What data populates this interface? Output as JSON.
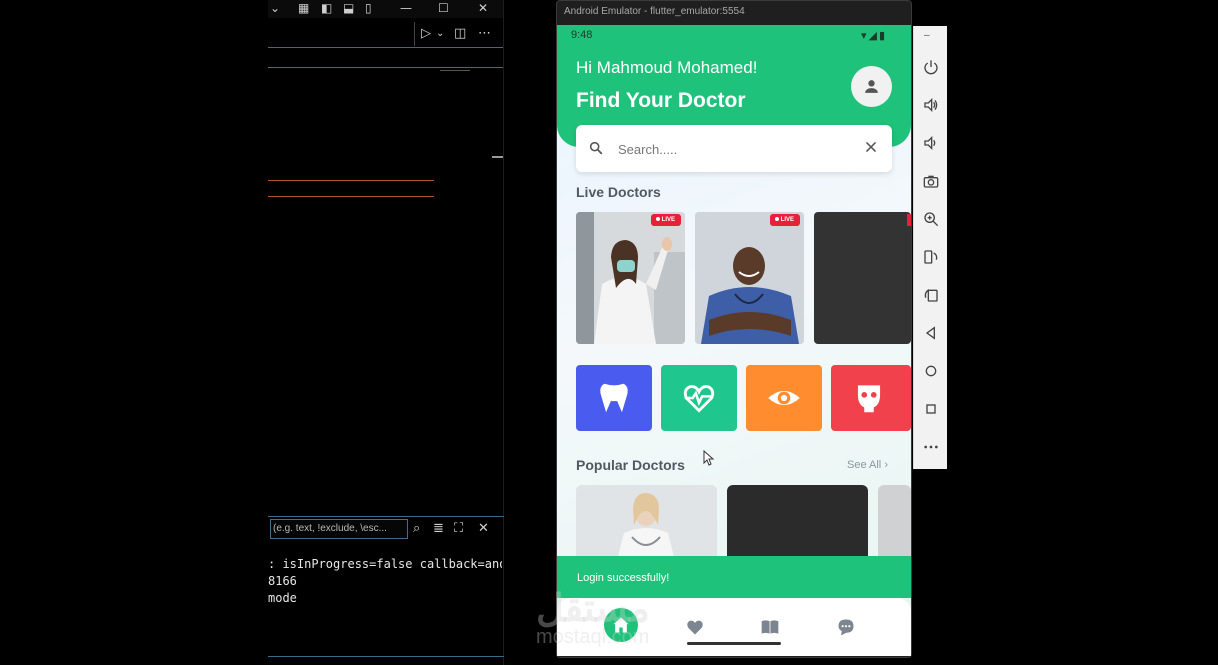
{
  "emulator": {
    "window_title": "Android Emulator - flutter_emulator:5554"
  },
  "ide": {
    "find_placeholder": "(e.g. text, !exclude, \\esc...",
    "console_lines": [
      ": isInProgress=false callback=andr",
      "8166",
      "mode"
    ]
  },
  "app": {
    "status_time": "9:48",
    "greeting": "Hi Mahmoud Mohamed!",
    "title": "Find Your Doctor",
    "search_placeholder": "Search.....",
    "live_section_title": "Live Doctors",
    "live_badge": "LIVE",
    "popular_section_title": "Popular Doctors",
    "see_all": "See All",
    "toast": "Login successfully!",
    "specialties": [
      {
        "icon": "tooth-icon",
        "color": "#4a5cf0"
      },
      {
        "icon": "heart-pulse-icon",
        "color": "#1fc78f"
      },
      {
        "icon": "eye-icon",
        "color": "#ff8c2e"
      },
      {
        "icon": "body-icon",
        "color": "#f0414c"
      }
    ],
    "nav_items": [
      "home-icon",
      "heart-icon",
      "book-icon",
      "chat-icon"
    ]
  },
  "watermark": {
    "arabic": "مستقل",
    "latin": "mostaql.com"
  },
  "colors": {
    "primary_green": "#1fc27a",
    "live_red": "#e8213a"
  }
}
